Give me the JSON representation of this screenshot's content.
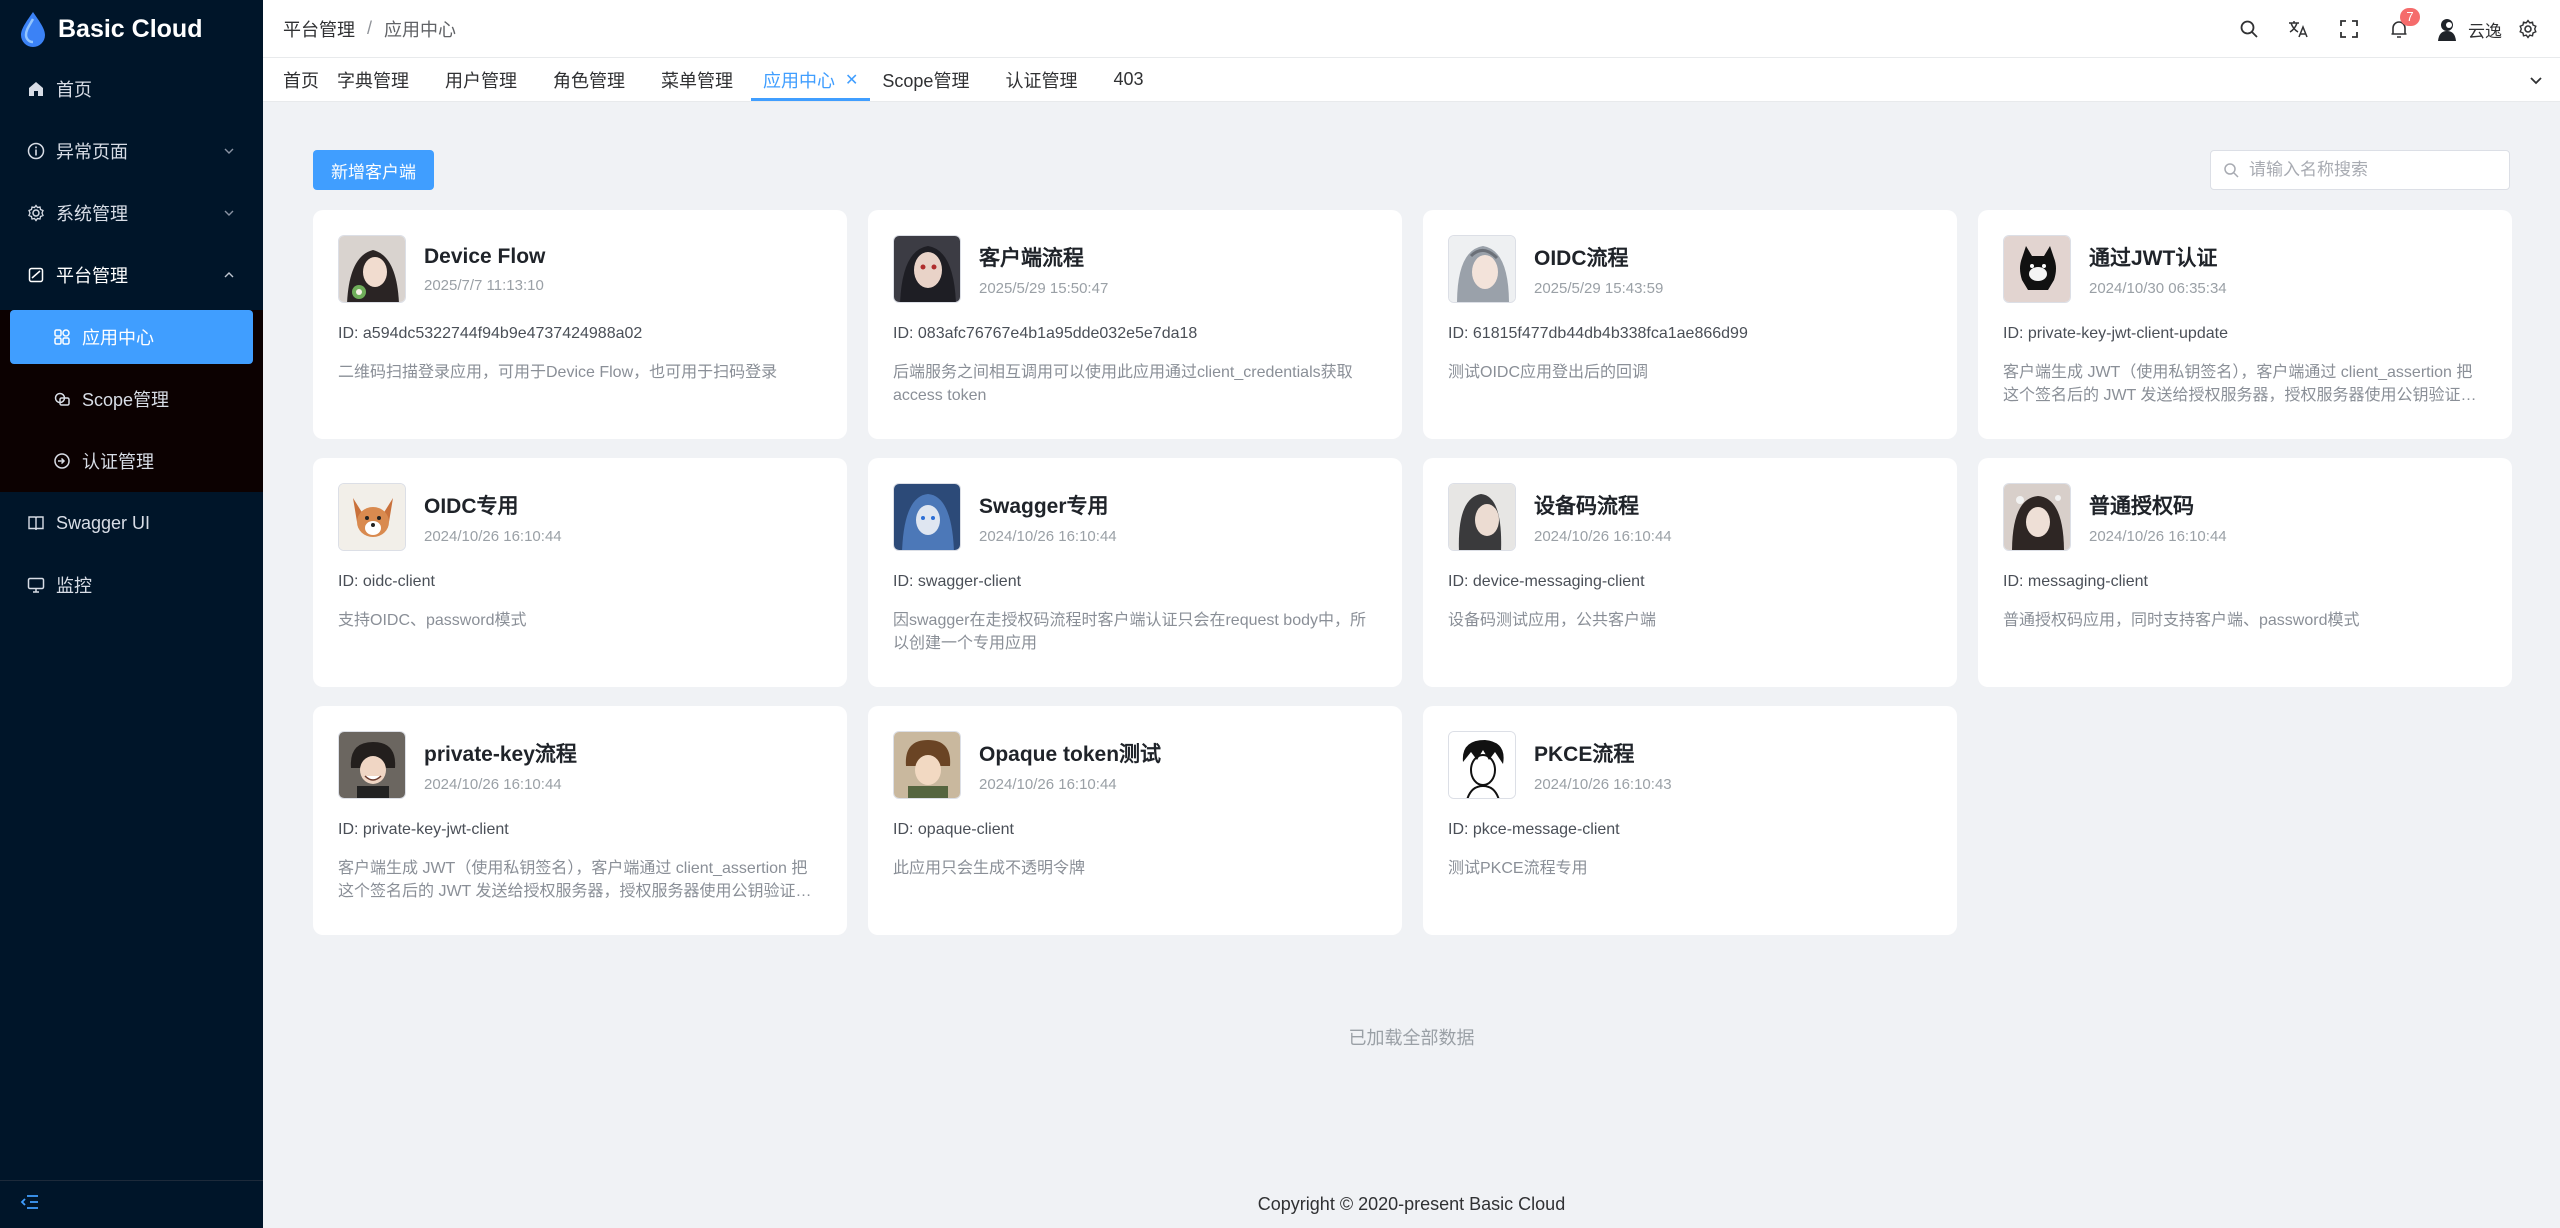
{
  "app": {
    "title": "Basic Cloud"
  },
  "sidebar": {
    "items": [
      {
        "label": "首页",
        "icon": "home-icon"
      },
      {
        "label": "异常页面",
        "icon": "info-icon"
      },
      {
        "label": "系统管理",
        "icon": "gear-icon"
      },
      {
        "label": "平台管理",
        "icon": "platform-icon"
      }
    ],
    "submenu": [
      {
        "label": "应用中心",
        "icon": "grid-icon",
        "active": true
      },
      {
        "label": "Scope管理",
        "icon": "scope-icon"
      },
      {
        "label": "认证管理",
        "icon": "auth-icon"
      }
    ],
    "bottom_items": [
      {
        "label": "Swagger UI",
        "icon": "book-icon"
      },
      {
        "label": "监控",
        "icon": "monitor-icon"
      }
    ]
  },
  "header": {
    "breadcrumb": [
      "平台管理",
      "应用中心"
    ],
    "notification_count": "7",
    "user_name": "云逸"
  },
  "tabs": [
    {
      "label": "首页"
    },
    {
      "label": "字典管理"
    },
    {
      "label": "用户管理"
    },
    {
      "label": "角色管理"
    },
    {
      "label": "菜单管理"
    },
    {
      "label": "应用中心",
      "active": true
    },
    {
      "label": "Scope管理"
    },
    {
      "label": "认证管理"
    },
    {
      "label": "403"
    }
  ],
  "toolbar": {
    "add_label": "新增客户端",
    "search_placeholder": "请输入名称搜索"
  },
  "cards": [
    {
      "title": "Device Flow",
      "time": "2025/7/7 11:13:10",
      "id": "ID: a594dc5322744f94b9e4737424988a02",
      "desc": "二维码扫描登录应用，可用于Device Flow，也可用于扫码登录"
    },
    {
      "title": "客户端流程",
      "time": "2025/5/29 15:50:47",
      "id": "ID: 083afc76767e4b1a95dde032e5e7da18",
      "desc": "后端服务之间相互调用可以使用此应用通过client_credentials获取access token"
    },
    {
      "title": "OIDC流程",
      "time": "2025/5/29 15:43:59",
      "id": "ID: 61815f477db44db4b338fca1ae866d99",
      "desc": "测试OIDC应用登出后的回调"
    },
    {
      "title": "通过JWT认证",
      "time": "2024/10/30 06:35:34",
      "id": "ID: private-key-jwt-client-update",
      "desc": "客户端生成 JWT（使用私钥签名），客户端通过 client_assertion 把这个签名后的 JWT 发送给授权服务器，授权服务器使用公钥验证签名"
    },
    {
      "title": "OIDC专用",
      "time": "2024/10/26 16:10:44",
      "id": "ID: oidc-client",
      "desc": "支持OIDC、password模式"
    },
    {
      "title": "Swagger专用",
      "time": "2024/10/26 16:10:44",
      "id": "ID: swagger-client",
      "desc": "因swagger在走授权码流程时客户端认证只会在request body中，所以创建一个专用应用"
    },
    {
      "title": "设备码流程",
      "time": "2024/10/26 16:10:44",
      "id": "ID: device-messaging-client",
      "desc": "设备码测试应用，公共客户端"
    },
    {
      "title": "普通授权码",
      "time": "2024/10/26 16:10:44",
      "id": "ID: messaging-client",
      "desc": "普通授权码应用，同时支持客户端、password模式"
    },
    {
      "title": "private-key流程",
      "time": "2024/10/26 16:10:44",
      "id": "ID: private-key-jwt-client",
      "desc": "客户端生成 JWT（使用私钥签名），客户端通过 client_assertion 把这个签名后的 JWT 发送给授权服务器，授权服务器使用公钥验证签名"
    },
    {
      "title": "Opaque token测试",
      "time": "2024/10/26 16:10:44",
      "id": "ID: opaque-client",
      "desc": "此应用只会生成不透明令牌"
    },
    {
      "title": "PKCE流程",
      "time": "2024/10/26 16:10:43",
      "id": "ID: pkce-message-client",
      "desc": "测试PKCE流程专用"
    }
  ],
  "status": {
    "loaded_text": "已加载全部数据"
  },
  "footer": {
    "copyright": "Copyright © 2020-present Basic Cloud"
  },
  "colors": {
    "accent": "#409eff",
    "sidebar_bg": "#001529",
    "badge": "#f56c6c"
  }
}
